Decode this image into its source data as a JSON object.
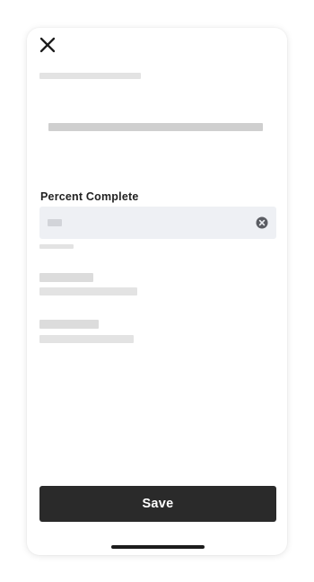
{
  "header": {
    "close_icon": "close-icon"
  },
  "form": {
    "field_label": "Percent Complete",
    "input_value": "",
    "clear_icon": "clear-circle-icon"
  },
  "footer": {
    "save_label": "Save"
  },
  "colors": {
    "save_button_bg": "#2a2a2a",
    "input_bg": "#eef0f4",
    "skeleton": "#e3e3e3"
  }
}
